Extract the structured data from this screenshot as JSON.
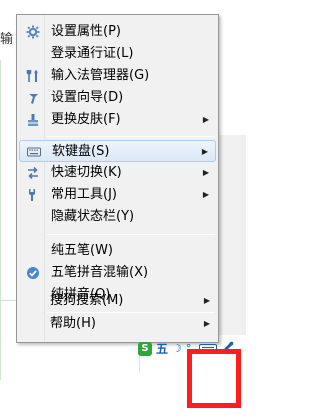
{
  "background": {
    "partial_text": "输"
  },
  "menu": {
    "groups": [
      [
        {
          "label": "设置属性(P)",
          "icon": "gear-icon",
          "submenu": false
        },
        {
          "label": "登录通行证(L)",
          "icon": "",
          "submenu": false
        },
        {
          "label": "输入法管理器(G)",
          "icon": "tools-icon",
          "submenu": false
        },
        {
          "label": "设置向导(D)",
          "icon": "wand-icon",
          "submenu": false
        },
        {
          "label": "更换皮肤(F)",
          "icon": "brush-icon",
          "submenu": true
        }
      ],
      [
        {
          "label": "软键盘(S)",
          "icon": "keyboard-icon",
          "submenu": true,
          "highlighted": true
        },
        {
          "label": "快速切换(K)",
          "icon": "switch-icon",
          "submenu": true
        },
        {
          "label": "常用工具(J)",
          "icon": "wrench-icon",
          "submenu": true
        },
        {
          "label": "隐藏状态栏(Y)",
          "icon": "",
          "submenu": false
        }
      ],
      [
        {
          "label": "纯五笔(W)",
          "icon": "",
          "submenu": false
        },
        {
          "label": "五笔拼音混输(X)",
          "icon": "check-icon",
          "submenu": false,
          "checked": true
        },
        {
          "label": "纯拼音(Q)",
          "icon": "",
          "submenu": false
        }
      ],
      [
        {
          "label": "搜狗搜索(M)",
          "icon": "",
          "submenu": true
        },
        {
          "label": "帮助(H)",
          "icon": "",
          "submenu": true
        }
      ]
    ]
  },
  "imebar": {
    "logo_text": "S",
    "mode_text": "五",
    "moon_glyph": "☽",
    "punct_glyph": "°,",
    "tool_glyph": "🔧"
  },
  "colors": {
    "highlight_border": "#aecbf0",
    "icon_blue": "#4a7fbd",
    "annotation_red": "#ff1d1d",
    "ime_logo_green": "#2fa63a"
  }
}
